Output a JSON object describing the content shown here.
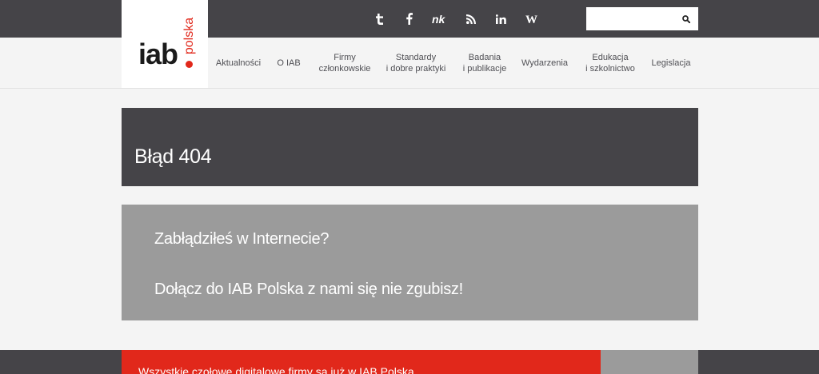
{
  "logo": {
    "text": "iab",
    "subtext": "polska",
    "accent_color": "#e1281b"
  },
  "social": [
    {
      "name": "twitter-icon",
      "glyph": "t"
    },
    {
      "name": "facebook-icon",
      "glyph": "f"
    },
    {
      "name": "nk-icon",
      "glyph": "nk"
    },
    {
      "name": "rss-icon",
      "glyph": "rss"
    },
    {
      "name": "linkedin-icon",
      "glyph": "in"
    },
    {
      "name": "wikipedia-icon",
      "glyph": "W"
    }
  ],
  "search": {
    "placeholder": "",
    "icon": "search-icon"
  },
  "nav": {
    "items": [
      {
        "line1": "Aktualności",
        "line2": ""
      },
      {
        "line1": "O IAB",
        "line2": ""
      },
      {
        "line1": "Firmy",
        "line2": "członkowskie"
      },
      {
        "line1": "Standardy",
        "line2": "i dobre praktyki"
      },
      {
        "line1": "Badania",
        "line2": "i publikacje"
      },
      {
        "line1": "Wydarzenia",
        "line2": ""
      },
      {
        "line1": "Edukacja",
        "line2": "i szkolnictwo"
      },
      {
        "line1": "Legislacja",
        "line2": ""
      }
    ]
  },
  "hero": {
    "title": "Błąd 404"
  },
  "message": {
    "line1": "Zabłądziłeś w Internecie?",
    "line2": "Dołącz do IAB Polska z nami się nie zgubisz!"
  },
  "footer": {
    "banner": "Wszystkie czołowe digitalowe firmy są już w IAB Polska"
  },
  "colors": {
    "dark": "#454448",
    "red": "#e1281b",
    "gray": "#9b9b9b",
    "bg": "#f4f4f4"
  }
}
